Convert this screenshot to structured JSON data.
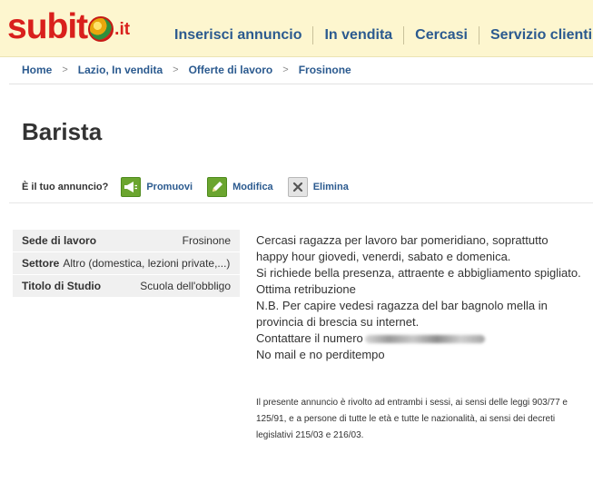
{
  "header": {
    "logo_word": "subit",
    "logo_tld": ".it",
    "nav": [
      "Inserisci annuncio",
      "In vendita",
      "Cercasi",
      "Servizio clienti"
    ]
  },
  "breadcrumb": [
    "Home",
    "Lazio, In vendita",
    "Offerte di lavoro",
    "Frosinone"
  ],
  "ad": {
    "title": "Barista",
    "owner_question": "È il tuo annuncio?",
    "actions": {
      "promote": "Promuovi",
      "edit": "Modifica",
      "delete": "Elimina"
    }
  },
  "details": [
    {
      "key": "Sede di lavoro",
      "value": "Frosinone"
    },
    {
      "key": "Settore",
      "value": "Altro (domestica, lezioni private,...)"
    },
    {
      "key": "Titolo di Studio",
      "value": "Scuola dell'obbligo"
    }
  ],
  "description": {
    "lines": [
      "Cercasi ragazza per lavoro bar pomeridiano, soprattutto happy hour giovedi, venerdi, sabato e domenica.",
      "Si richiede bella presenza, attraente e abbigliamento spigliato.",
      "Ottima retribuzione",
      "N.B. Per capire vedesi ragazza del bar bagnolo mella in provincia di brescia su internet."
    ],
    "contact_label": "Contattare il numero",
    "closing": "No mail e no perditempo",
    "legal": "Il presente annuncio è rivolto ad entrambi i sessi, ai sensi delle leggi 903/77 e 125/91, e a persone di tutte le età e tutte le nazionalità, ai sensi dei decreti legislativi 215/03 e 216/03."
  },
  "colors": {
    "brand_red": "#d9201c",
    "link_blue": "#2b5a8f",
    "header_bg": "#fdf6cf",
    "action_green": "#6ba52f"
  }
}
